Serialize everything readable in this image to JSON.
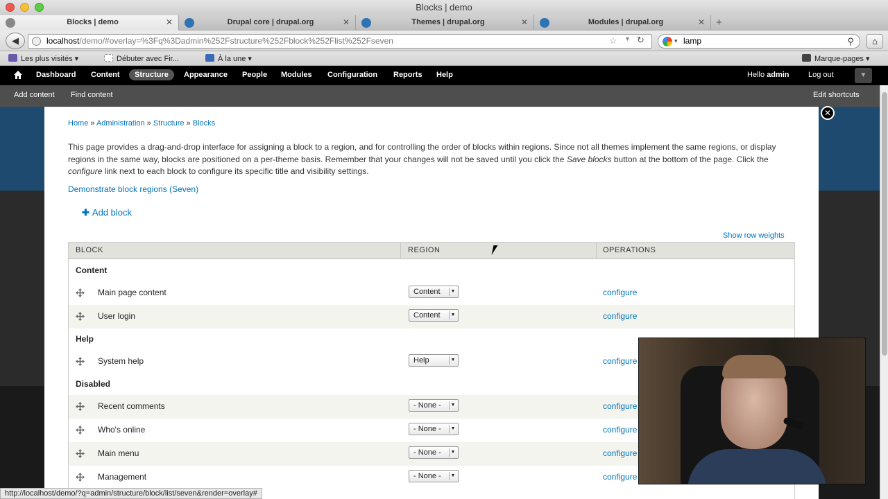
{
  "window": {
    "title": "Blocks | demo"
  },
  "tabs": [
    {
      "label": "Blocks | demo",
      "active": true
    },
    {
      "label": "Drupal core | drupal.org",
      "active": false
    },
    {
      "label": "Themes | drupal.org",
      "active": false
    },
    {
      "label": "Modules | drupal.org",
      "active": false
    }
  ],
  "address": {
    "host": "localhost",
    "path": "/demo/#overlay=%3Fq%3Dadmin%252Fstructure%252Fblock%252Flist%252Fseven"
  },
  "search": {
    "value": "lamp"
  },
  "bookmarks": [
    {
      "label": "Les plus visités",
      "icon_color": "#6b5aa8",
      "dropdown": true
    },
    {
      "label": "Débuter avec Fir...",
      "icon_color": "#dddddd",
      "dropdown": false
    },
    {
      "label": "À la une",
      "icon_color": "#3b6bb5",
      "dropdown": true
    }
  ],
  "bookmarks_right": "Marque-pages",
  "toolbar": {
    "items": [
      "Dashboard",
      "Content",
      "Structure",
      "Appearance",
      "People",
      "Modules",
      "Configuration",
      "Reports",
      "Help"
    ],
    "active": "Structure",
    "hello_prefix": "Hello ",
    "user": "admin",
    "logout": "Log out"
  },
  "shortcuts": {
    "add_content": "Add content",
    "find_content": "Find content",
    "edit_shortcuts": "Edit shortcuts"
  },
  "breadcrumb": {
    "home": "Home",
    "admin": "Administration",
    "structure": "Structure",
    "blocks": "Blocks",
    "sep": " » "
  },
  "help": {
    "p1": "This page provides a drag-and-drop interface for assigning a block to a region, and for controlling the order of blocks within regions. Since not all themes implement the same regions, or display regions in the same way, blocks are positioned on a per-theme basis. Remember that your changes will not be saved until you click the ",
    "save_blocks": "Save blocks",
    "p2": " button at the bottom of the page. Click the ",
    "configure": "configure",
    "p3": " link next to each block to configure its specific title and visibility settings."
  },
  "demo_link": "Demonstrate block regions (Seven)",
  "add_block": "Add block",
  "row_weights": "Show row weights",
  "table": {
    "headers": {
      "block": "BLOCK",
      "region": "REGION",
      "operations": "OPERATIONS"
    },
    "groups": [
      {
        "name": "Content",
        "rows": [
          {
            "block": "Main page content",
            "region": "Content",
            "op": "configure"
          },
          {
            "block": "User login",
            "region": "Content",
            "op": "configure"
          }
        ]
      },
      {
        "name": "Help",
        "rows": [
          {
            "block": "System help",
            "region": "Help",
            "op": "configure"
          }
        ]
      },
      {
        "name": "Disabled",
        "rows": [
          {
            "block": "Recent comments",
            "region": "- None -",
            "op": "configure"
          },
          {
            "block": "Who's online",
            "region": "- None -",
            "op": "configure"
          },
          {
            "block": "Main menu",
            "region": "- None -",
            "op": "configure"
          },
          {
            "block": "Management",
            "region": "- None -",
            "op": "configure"
          }
        ]
      }
    ]
  },
  "status_url": "http://localhost/demo/?q=admin/structure/block/list/seven&render=overlay#",
  "colors": {
    "link": "#0074bd",
    "toolbar": "#000000",
    "shortcut_bar": "#4e4e4e"
  }
}
